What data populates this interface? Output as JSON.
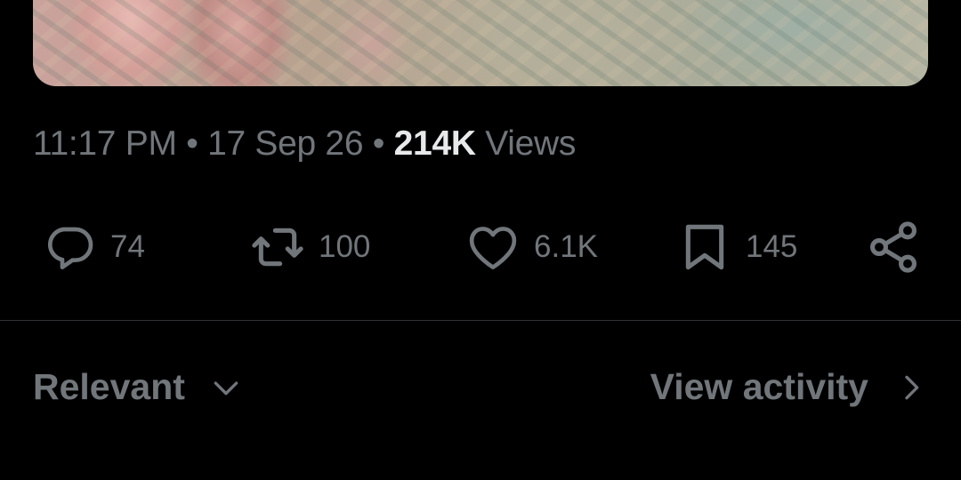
{
  "post": {
    "time": "11:17 PM",
    "date": "17 Sep 26",
    "separator": "•",
    "views_count": "214K",
    "views_label": "Views"
  },
  "actions": {
    "replies": "74",
    "reposts": "100",
    "likes": "6.1K",
    "bookmarks": "145"
  },
  "replies_header": {
    "sort_label": "Relevant",
    "activity_label": "View activity"
  },
  "icons": {
    "reply": "reply-icon",
    "repost": "repost-icon",
    "like": "heart-icon",
    "bookmark": "bookmark-icon",
    "share": "share-icon",
    "sort_chevron": "chevron-down-icon",
    "activity_chevron": "chevron-right-icon"
  },
  "colors": {
    "background": "#000000",
    "secondary_text": "#71767b",
    "primary_text": "#e7e9ea",
    "divider": "#2f3336"
  }
}
